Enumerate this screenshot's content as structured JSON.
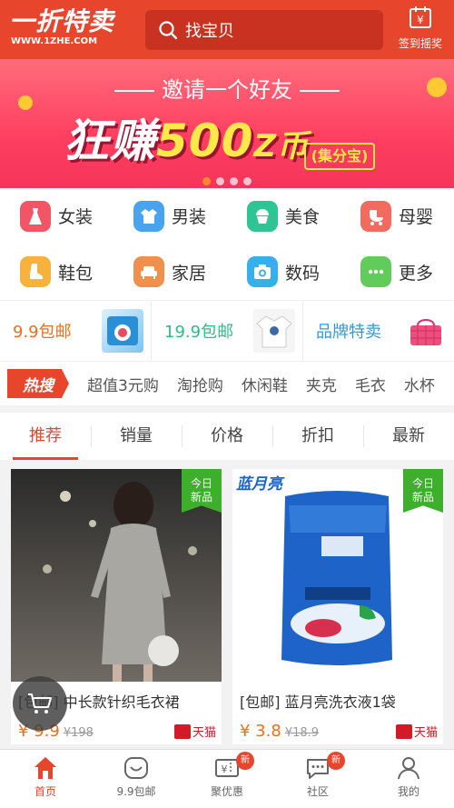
{
  "header": {
    "logo_text": "一折特卖",
    "logo_url_text": "WWW.1ZHE.COM",
    "search_placeholder": "找宝贝",
    "signin_label": "签到摇奖"
  },
  "banner": {
    "subtitle": "邀请一个好友",
    "headline_prefix": "狂赚",
    "headline_number": "500",
    "headline_suffix": "Z币",
    "tag": "(集分宝)",
    "slides": 4,
    "active_slide": 1
  },
  "categories": [
    {
      "label": "女装",
      "icon": "dress-icon",
      "color": "#f25566"
    },
    {
      "label": "男装",
      "icon": "shirt-icon",
      "color": "#4aa3ee"
    },
    {
      "label": "美食",
      "icon": "cupcake-icon",
      "color": "#2fc493"
    },
    {
      "label": "母婴",
      "icon": "stroller-icon",
      "color": "#f56a5e"
    },
    {
      "label": "鞋包",
      "icon": "boot-icon",
      "color": "#f7b23b"
    },
    {
      "label": "家居",
      "icon": "sofa-icon",
      "color": "#f18f4c"
    },
    {
      "label": "数码",
      "icon": "camera-icon",
      "color": "#35b0ea"
    },
    {
      "label": "更多",
      "icon": "more-icon",
      "color": "#61cc5a"
    }
  ],
  "promos": [
    {
      "label": "9.9包邮",
      "color": "#f36d18"
    },
    {
      "label": "19.9包邮",
      "color": "#2bbd86"
    },
    {
      "label": "品牌特卖",
      "color": "#2c9be0"
    }
  ],
  "hot": {
    "badge": "热搜",
    "keywords": [
      "超值3元购",
      "淘抢购",
      "休闲鞋",
      "夹克",
      "毛衣",
      "水杯"
    ]
  },
  "tabs": [
    "推荐",
    "销量",
    "价格",
    "折扣",
    "最新"
  ],
  "active_tab": 0,
  "products": [
    {
      "badge_line1": "今日",
      "badge_line2": "新品",
      "title": "[包邮] 中长款针织毛衣裙",
      "price": "¥ 9.9",
      "original": "¥198",
      "shop": "天猫"
    },
    {
      "badge_line1": "今日",
      "badge_line2": "新品",
      "title": "[包邮] 蓝月亮洗衣液1袋",
      "price": "¥ 3.8",
      "original": "¥18.9",
      "shop": "天猫",
      "brand": "蓝月亮"
    }
  ],
  "nav": [
    {
      "label": "首页",
      "icon": "home-icon",
      "active": true
    },
    {
      "label": "9.9包邮",
      "icon": "smile-bag-icon",
      "active": false
    },
    {
      "label": "聚优惠",
      "icon": "coupon-icon",
      "active": false,
      "badge": "新"
    },
    {
      "label": "社区",
      "icon": "chat-icon",
      "active": false,
      "badge": "新"
    },
    {
      "label": "我的",
      "icon": "user-icon",
      "active": false
    }
  ]
}
